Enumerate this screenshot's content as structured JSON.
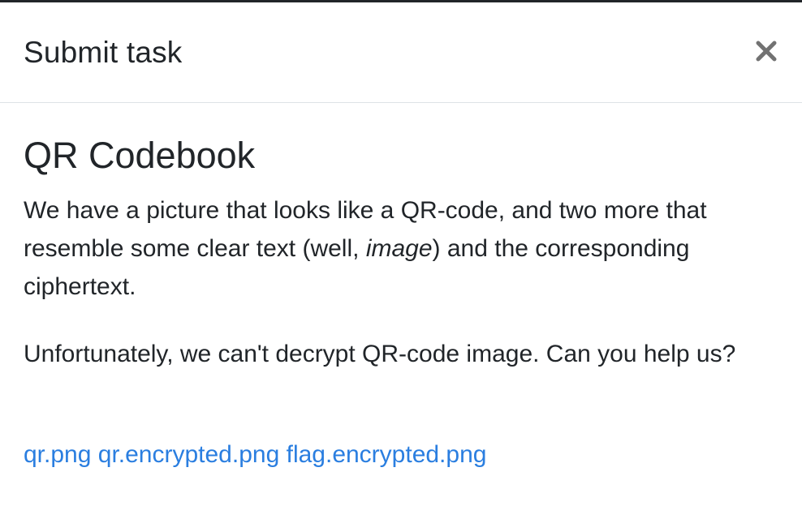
{
  "modal": {
    "title": "Submit task",
    "close_label": "×"
  },
  "task": {
    "title": "QR Codebook",
    "description_part1": "We have a picture that looks like a QR-code, and two more that resemble some clear text (well, ",
    "description_emphasis": "image",
    "description_part2": ") and the corresponding ciphertext.",
    "description2": "Unfortunately, we can't decrypt QR-code image. Can you help us?",
    "files": [
      {
        "label": "qr.png"
      },
      {
        "label": "qr.encrypted.png"
      },
      {
        "label": "flag.encrypted.png"
      }
    ]
  },
  "colors": {
    "link": "#2a7ee0",
    "text": "#212529",
    "divider": "#dee2e6"
  },
  "icons": {
    "close": "close-icon"
  }
}
